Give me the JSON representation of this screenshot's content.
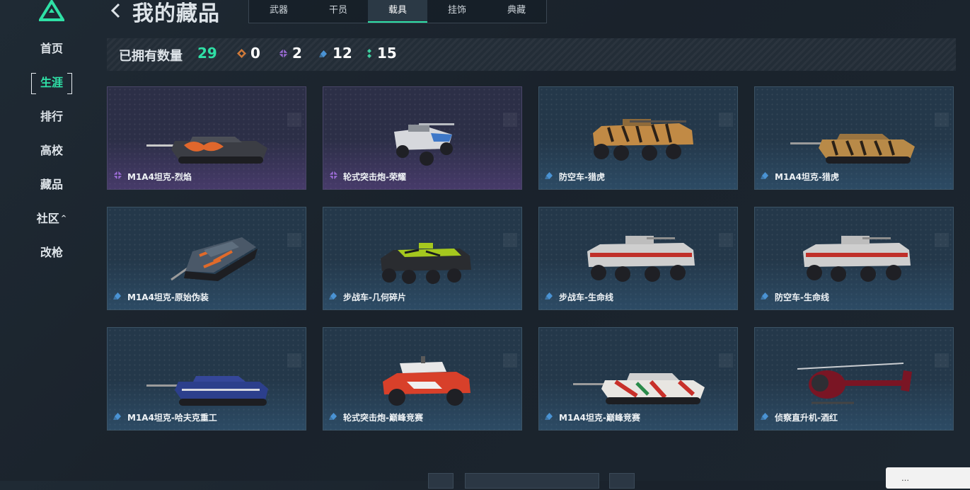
{
  "sidebar": {
    "items": [
      {
        "label": "首页"
      },
      {
        "label": "生涯"
      },
      {
        "label": "排行"
      },
      {
        "label": "高校"
      },
      {
        "label": "藏品"
      },
      {
        "label": "社区"
      },
      {
        "label": "改枪"
      }
    ],
    "active_index": 1
  },
  "header": {
    "title": "我的藏品",
    "tabs": [
      {
        "label": "武器"
      },
      {
        "label": "干员"
      },
      {
        "label": "载具"
      },
      {
        "label": "挂饰"
      },
      {
        "label": "典藏"
      }
    ],
    "active_tab": 2
  },
  "stats": {
    "label": "已拥有数量",
    "total": "29",
    "counts": [
      {
        "rarity": "orange",
        "value": "0"
      },
      {
        "rarity": "purple",
        "value": "2"
      },
      {
        "rarity": "blue",
        "value": "12"
      },
      {
        "rarity": "green",
        "value": "15"
      }
    ]
  },
  "colors": {
    "accent": "#2fe0a6",
    "orange": "#d07a3a",
    "purple": "#9b6cd6",
    "blue": "#4a93d4",
    "green": "#3fd0a0"
  },
  "items": [
    {
      "name": "M1A4坦克-烈焰",
      "rarity": "purple",
      "icon": "tank-icon"
    },
    {
      "name": "轮式突击炮-荣耀",
      "rarity": "purple",
      "icon": "assault-vehicle-icon"
    },
    {
      "name": "防空车-猎虎",
      "rarity": "blue",
      "icon": "apc-icon"
    },
    {
      "name": "M1A4坦克-猎虎",
      "rarity": "blue",
      "icon": "tank-icon"
    },
    {
      "name": "M1A4坦克-原始伪装",
      "rarity": "blue",
      "icon": "tank-icon"
    },
    {
      "name": "步战车-几何碎片",
      "rarity": "blue",
      "icon": "apc-icon"
    },
    {
      "name": "步战车-生命线",
      "rarity": "blue",
      "icon": "apc-icon"
    },
    {
      "name": "防空车-生命线",
      "rarity": "blue",
      "icon": "apc-icon"
    },
    {
      "name": "M1A4坦克-哈夫克重工",
      "rarity": "blue",
      "icon": "tank-icon"
    },
    {
      "name": "轮式突击炮-巅峰竞赛",
      "rarity": "blue",
      "icon": "assault-vehicle-icon"
    },
    {
      "name": "M1A4坦克-巅峰竞赛",
      "rarity": "blue",
      "icon": "tank-icon"
    },
    {
      "name": "侦察直升机-酒红",
      "rarity": "blue",
      "icon": "helicopter-icon"
    }
  ],
  "footer": {
    "toast": "…"
  }
}
